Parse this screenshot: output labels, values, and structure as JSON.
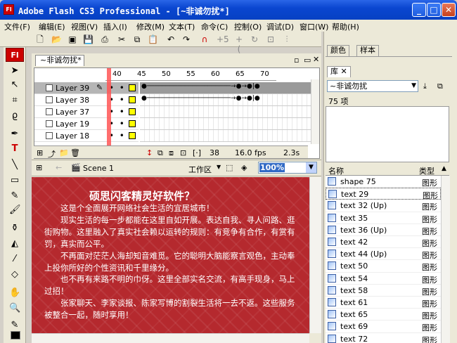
{
  "window": {
    "title": "Adobe Flash CS3 Professional - [~非诚勿扰*]"
  },
  "menu": [
    "文件(F)",
    "编辑(E)",
    "视图(V)",
    "插入(I)",
    "修改(M)",
    "文本(T)",
    "命令(C)",
    "控制(O)",
    "调试(D)",
    "窗口(W)",
    "帮助(H)"
  ],
  "document": {
    "tab": "~非诚勿扰*",
    "fl_logo": "Fl"
  },
  "timeline": {
    "ruler": [
      "40",
      "45",
      "50",
      "55",
      "60",
      "65",
      "70"
    ],
    "layers": [
      {
        "name": "Layer 39",
        "selected": true
      },
      {
        "name": "Layer 38",
        "selected": false
      },
      {
        "name": "Layer 37",
        "selected": false
      },
      {
        "name": "Layer 19",
        "selected": false
      },
      {
        "name": "Layer 18",
        "selected": false
      }
    ],
    "status": {
      "frame": "38",
      "fps": "16.0 fps",
      "time": "2.3s"
    }
  },
  "editbar": {
    "scene": "Scene 1",
    "workspace": "工作区",
    "zoom": "100%"
  },
  "stage": {
    "heading": "硕思闪客精灵好软件？",
    "lines": [
      "　　这是个全面展开网络社会生活的宜居城市！",
      "　　现实生活的每一步都能在这里自如开展。表达自我、寻人问路、逛街购物。这里融入了真实社会赖以运转的规则：有竞争有合作，有赏有罚，真实而公平。",
      "　　不再面对茫茫人海却知音难觅。它的聪明大脑能察言观色，主动奉上投你所好的个性资讯和千里缘分。",
      "　　也不再有来路不明的巾伢。这里全部实名交流，有高手现身，马上过招！",
      "　　张家聊天、李家谈报、陈家写博的割裂生活将一去不返。这些服务被整合一起，随时享用！"
    ]
  },
  "panels": {
    "tabs": [
      "颜色",
      "样本"
    ],
    "library_tab": "库",
    "library_select": "~非诚勿扰",
    "count": "75 项",
    "col_name": "名称",
    "col_type": "类型"
  },
  "library": [
    {
      "name": "shape 75",
      "type": "图形"
    },
    {
      "name": "text 29",
      "type": "图形"
    },
    {
      "name": "text 32 (Up)",
      "type": "图形"
    },
    {
      "name": "text 35",
      "type": "图形"
    },
    {
      "name": "text 36 (Up)",
      "type": "图形"
    },
    {
      "name": "text 42",
      "type": "图形"
    },
    {
      "name": "text 44 (Up)",
      "type": "图形"
    },
    {
      "name": "text 50",
      "type": "图形"
    },
    {
      "name": "text 54",
      "type": "图形"
    },
    {
      "name": "text 58",
      "type": "图形"
    },
    {
      "name": "text 61",
      "type": "图形"
    },
    {
      "name": "text 65",
      "type": "图形"
    },
    {
      "name": "text 69",
      "type": "图形"
    },
    {
      "name": "text 72",
      "type": "图形"
    }
  ]
}
